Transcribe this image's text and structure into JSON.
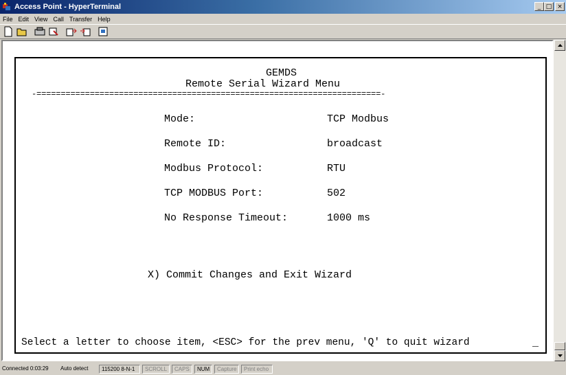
{
  "window": {
    "title": "Access Point - HyperTerminal"
  },
  "menubar": [
    "File",
    "Edit",
    "View",
    "Call",
    "Transfer",
    "Help"
  ],
  "toolbar": {
    "icons": [
      "new-icon",
      "open-icon",
      "disconnect-icon",
      "properties-icon",
      "send-icon",
      "receive-icon",
      "capture-icon"
    ]
  },
  "terminal": {
    "header_1": "GEMDS",
    "header_2": "Remote Serial Wizard Menu",
    "separator": "-=======================================================================-",
    "fields": [
      {
        "label": "Mode:",
        "value": "TCP Modbus"
      },
      {
        "label": "Remote ID:",
        "value": "broadcast"
      },
      {
        "label": "Modbus Protocol:",
        "value": "RTU"
      },
      {
        "label": "TCP MODBUS Port:",
        "value": "502"
      },
      {
        "label": "No Response Timeout:",
        "value": "1000 ms"
      }
    ],
    "commit": "X) Commit Changes and Exit Wizard",
    "prompt": "Select a letter to choose item, <ESC> for the prev menu, 'Q' to quit wizard",
    "cursor": "_"
  },
  "statusbar": {
    "connected": "Connected 0:03:29",
    "detect": "Auto detect",
    "settings": "115200 8-N-1",
    "scroll": "SCROLL",
    "caps": "CAPS",
    "num": "NUM",
    "capture": "Capture",
    "print": "Print echo"
  },
  "colors": {
    "titlebar_start": "#0a246a",
    "titlebar_end": "#a6caf0",
    "chrome": "#d4d0c8"
  }
}
